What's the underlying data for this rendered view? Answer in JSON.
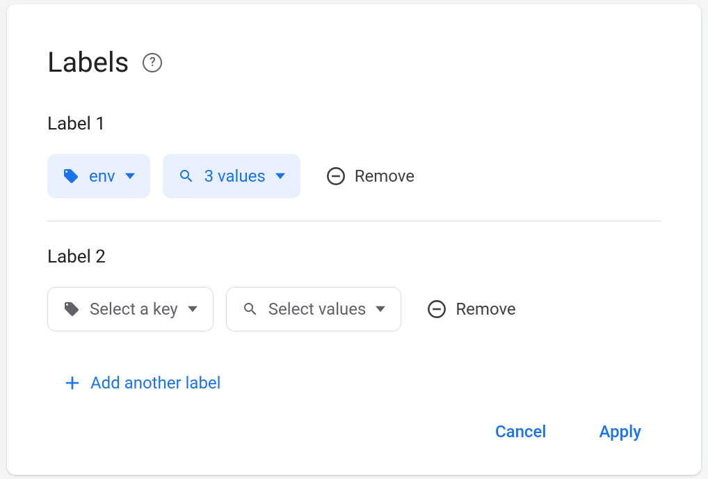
{
  "title": "Labels",
  "labels": [
    {
      "heading": "Label 1",
      "key_display": "env",
      "values_display": "3 values",
      "filled": true,
      "remove_label": "Remove"
    },
    {
      "heading": "Label 2",
      "key_display": "Select a key",
      "values_display": "Select values",
      "filled": false,
      "remove_label": "Remove"
    }
  ],
  "add_label": "Add another label",
  "footer": {
    "cancel": "Cancel",
    "apply": "Apply"
  }
}
